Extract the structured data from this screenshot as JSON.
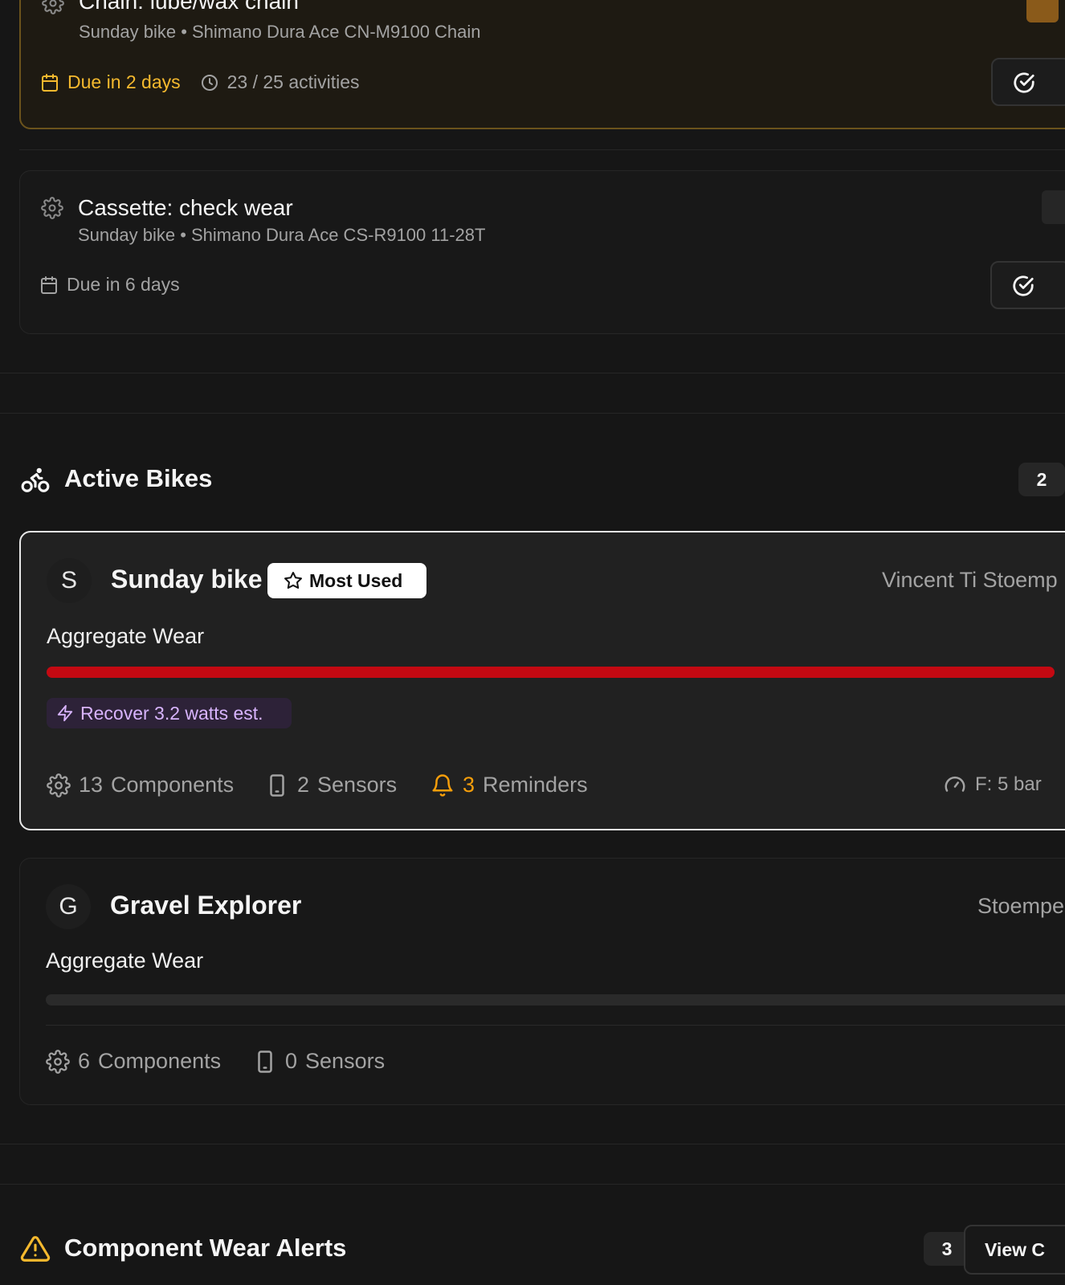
{
  "reminders": [
    {
      "title": "Chain: lube/wax chain",
      "subtitle": "Sunday bike • Shimano Dura Ace CN-M9100 Chain",
      "due": "Due in 2 days",
      "activities": "23 / 25 activities",
      "status": "warning"
    },
    {
      "title": "Cassette: check wear",
      "subtitle": "Sunday bike • Shimano Dura Ace CS-R9100 11-28T",
      "due": "Due in 6 days",
      "status": "normal"
    }
  ],
  "active_bikes": {
    "title": "Active Bikes",
    "count": "2",
    "bikes": [
      {
        "initial": "S",
        "name": "Sunday bike",
        "badge": "Most Used",
        "frame": "Vincent Ti Stoemp",
        "wear_label": "Aggregate Wear",
        "wear_fraction": 1.0,
        "recover": "Recover 3.2 watts est.",
        "components_count": "13",
        "components_label": "Components",
        "sensors_count": "2",
        "sensors_label": "Sensors",
        "reminders_count": "3",
        "reminders_label": "Reminders",
        "pressure": "F: 5 bar"
      },
      {
        "initial": "G",
        "name": "Gravel Explorer",
        "frame": "Stoempe",
        "wear_label": "Aggregate Wear",
        "wear_fraction": 0.0,
        "components_count": "6",
        "components_label": "Components",
        "sensors_count": "0",
        "sensors_label": "Sensors"
      }
    ]
  },
  "wear_alerts": {
    "title": "Component Wear Alerts",
    "count": "3",
    "view_label": "View C"
  },
  "colors": {
    "background": "#161616",
    "warning": "#f5b92e",
    "wear_bar": "#c40912",
    "recover_text": "#d8b4fe",
    "reminder_orange": "#f59e0b"
  }
}
